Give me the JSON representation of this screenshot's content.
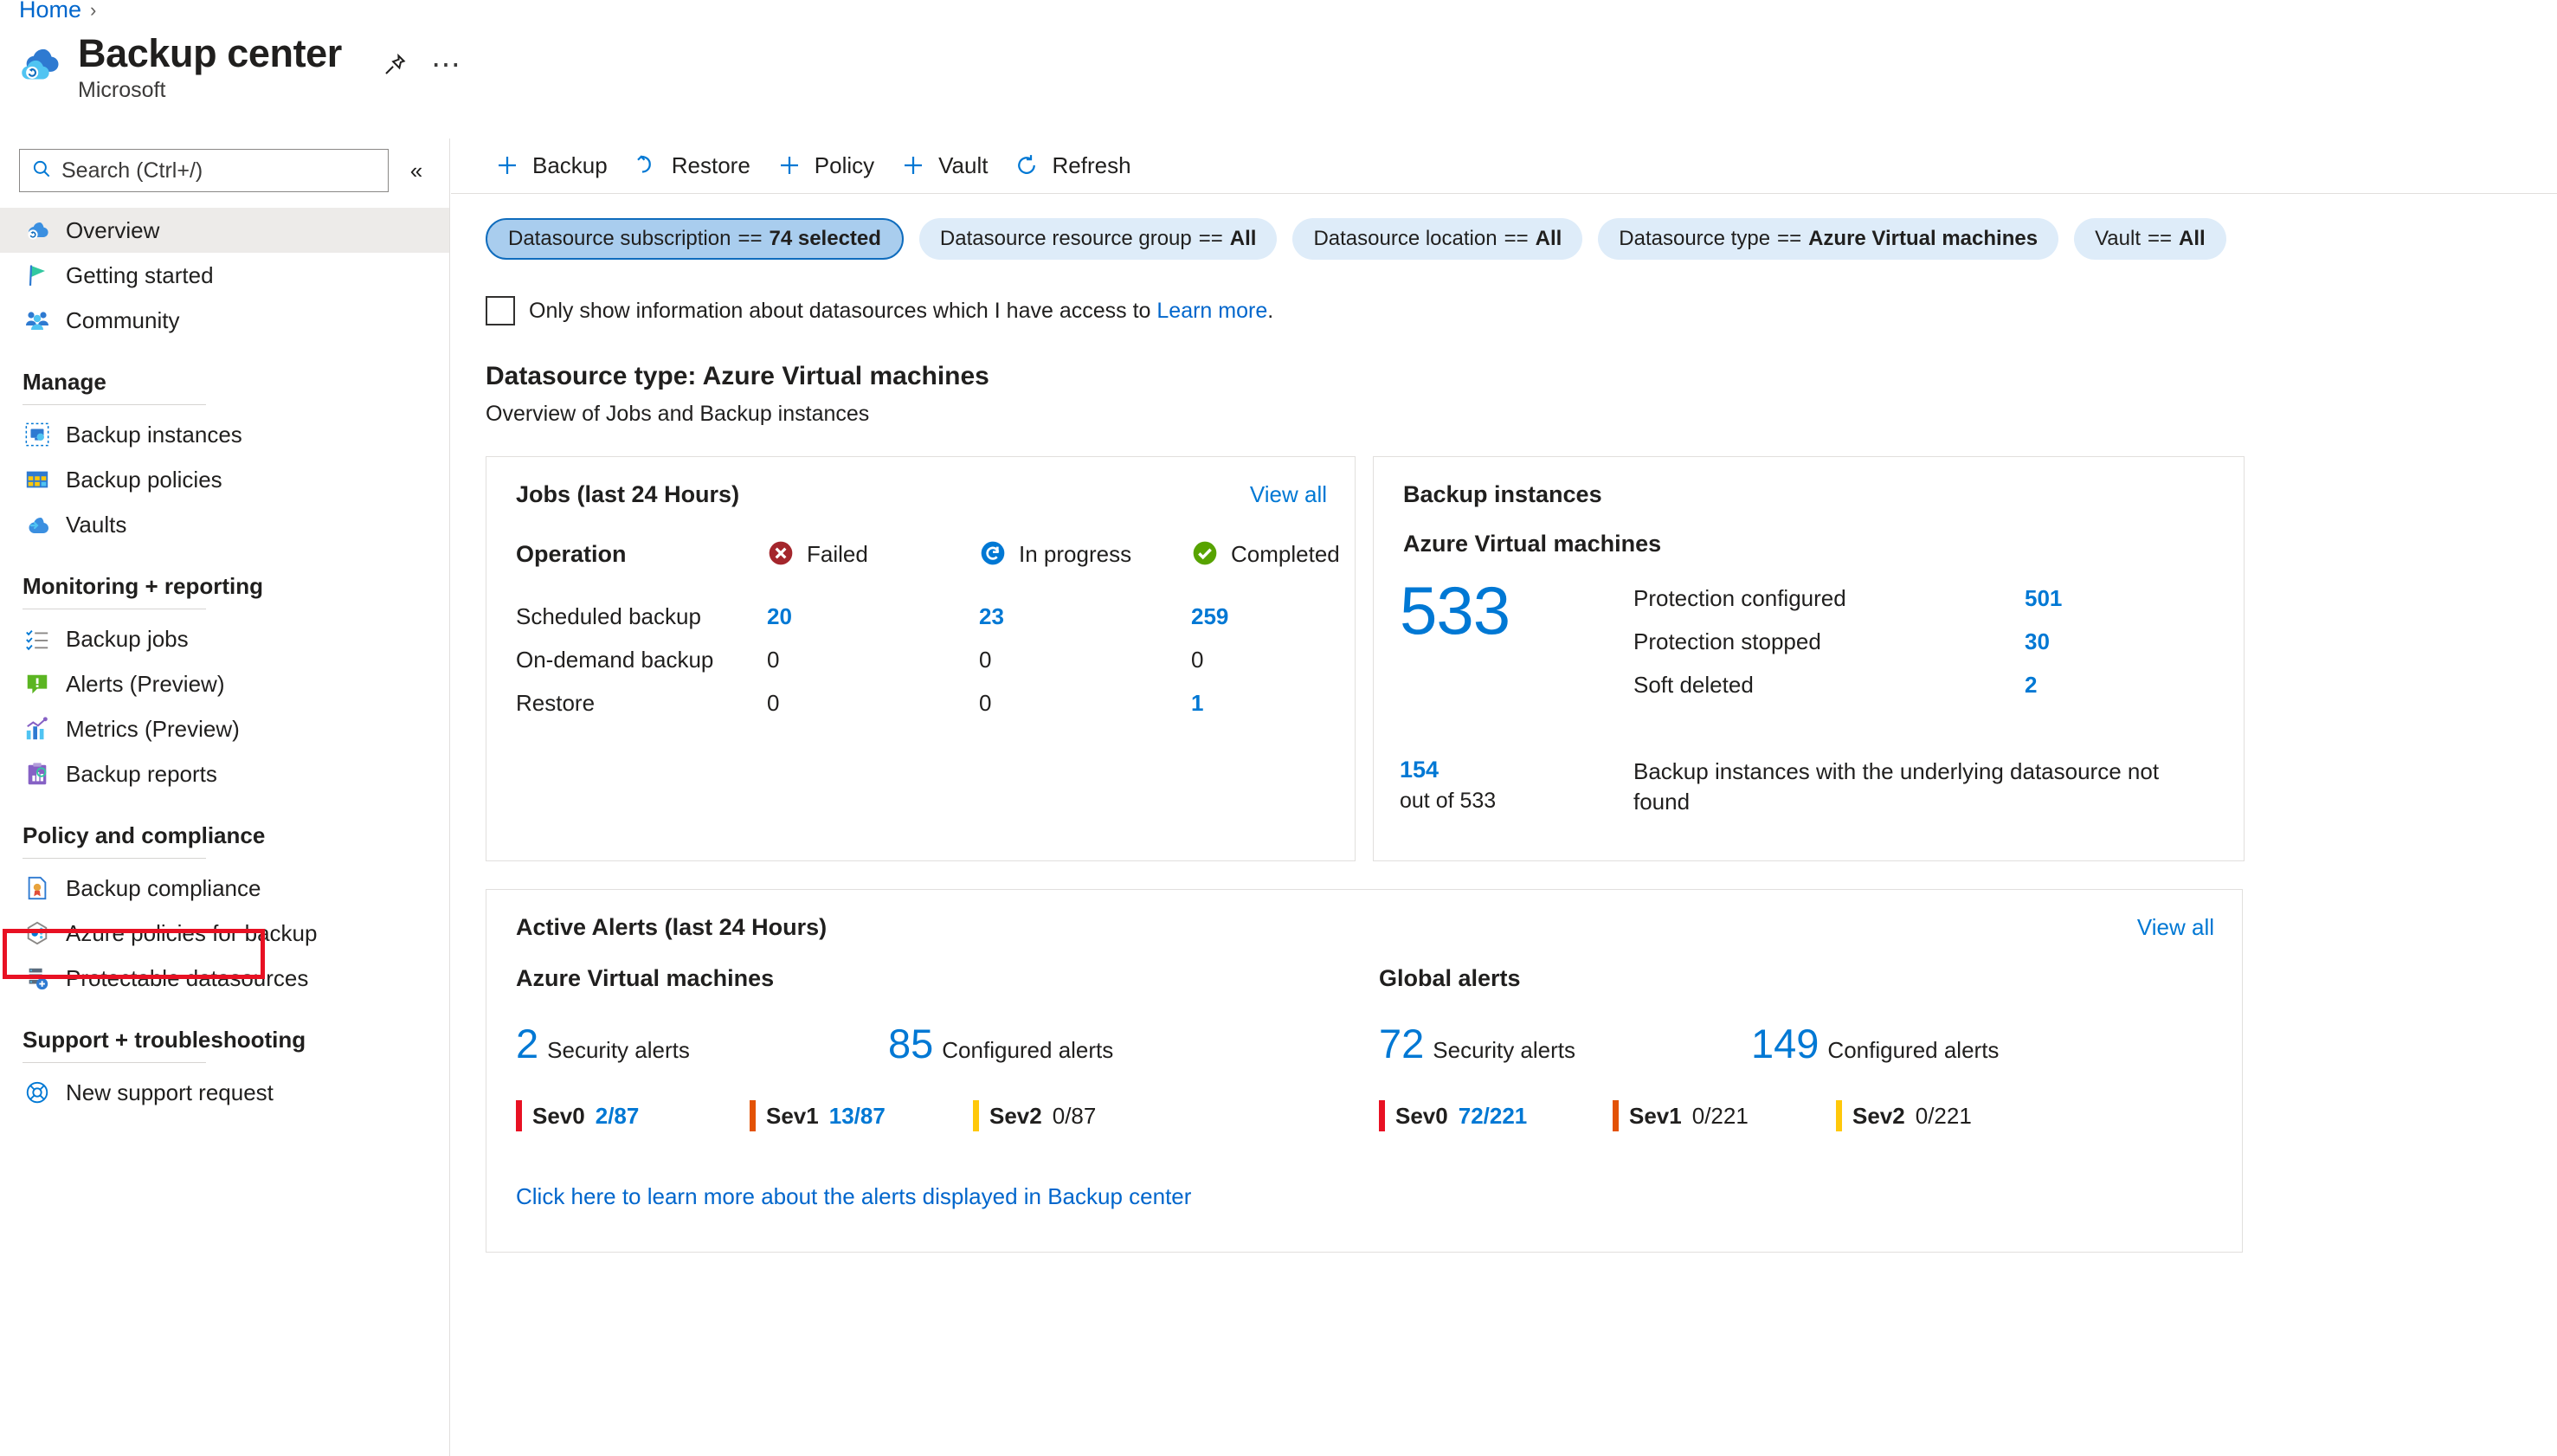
{
  "breadcrumb": {
    "home": "Home",
    "separator": "›"
  },
  "header": {
    "title": "Backup center",
    "subtitle": "Microsoft",
    "pin_label": "pin-icon",
    "more_label": "⋯"
  },
  "sidebar": {
    "search": {
      "placeholder": "Search (Ctrl+/)"
    },
    "collapse": "«",
    "top_items": [
      {
        "label": "Overview",
        "icon": "backup-center-icon",
        "active": true
      },
      {
        "label": "Getting started",
        "icon": "flag-icon",
        "active": false
      },
      {
        "label": "Community",
        "icon": "community-icon",
        "active": false
      }
    ],
    "groups": [
      {
        "title": "Manage",
        "items": [
          {
            "label": "Backup instances",
            "icon": "backup-instances-icon"
          },
          {
            "label": "Backup policies",
            "icon": "backup-policies-icon"
          },
          {
            "label": "Vaults",
            "icon": "vaults-icon"
          }
        ]
      },
      {
        "title": "Monitoring + reporting",
        "items": [
          {
            "label": "Backup jobs",
            "icon": "backup-jobs-icon"
          },
          {
            "label": "Alerts (Preview)",
            "icon": "alerts-icon"
          },
          {
            "label": "Metrics (Preview)",
            "icon": "metrics-icon",
            "highlighted": true
          },
          {
            "label": "Backup reports",
            "icon": "backup-reports-icon"
          }
        ]
      },
      {
        "title": "Policy and compliance",
        "items": [
          {
            "label": "Backup compliance",
            "icon": "compliance-icon"
          },
          {
            "label": "Azure policies for backup",
            "icon": "azure-policy-icon"
          },
          {
            "label": "Protectable datasources",
            "icon": "protectable-datasources-icon"
          }
        ]
      },
      {
        "title": "Support + troubleshooting",
        "items": [
          {
            "label": "New support request",
            "icon": "support-icon"
          }
        ]
      }
    ]
  },
  "toolbar": {
    "items": [
      {
        "label": "Backup",
        "icon": "plus-icon"
      },
      {
        "label": "Restore",
        "icon": "restore-icon"
      },
      {
        "label": "Policy",
        "icon": "plus-icon"
      },
      {
        "label": "Vault",
        "icon": "plus-icon"
      },
      {
        "label": "Refresh",
        "icon": "refresh-icon"
      }
    ]
  },
  "filters": [
    {
      "name": "Datasource subscription",
      "op": "==",
      "value": "74 selected",
      "selected": true
    },
    {
      "name": "Datasource resource group",
      "op": "==",
      "value": "All",
      "selected": false
    },
    {
      "name": "Datasource location",
      "op": "==",
      "value": "All",
      "selected": false
    },
    {
      "name": "Datasource type",
      "op": "==",
      "value": "Azure Virtual machines",
      "selected": false
    },
    {
      "name": "Vault",
      "op": "==",
      "value": "All",
      "selected": false
    }
  ],
  "access_row": {
    "checked": false,
    "text": "Only show information about datasources which I have access to ",
    "link": "Learn more",
    "period": "."
  },
  "page_section": {
    "title": "Datasource type: Azure Virtual machines",
    "subtitle": "Overview of Jobs and Backup instances"
  },
  "jobs_card": {
    "title": "Jobs (last 24 Hours)",
    "view_all": "View all",
    "columns": {
      "operation": "Operation",
      "failed": "Failed",
      "in_progress": "In progress",
      "completed": "Completed"
    },
    "rows": [
      {
        "operation": "Scheduled backup",
        "failed": "20",
        "failed_blue": true,
        "in_progress": "23",
        "in_progress_blue": true,
        "completed": "259",
        "completed_blue": true
      },
      {
        "operation": "On-demand backup",
        "failed": "0",
        "failed_blue": false,
        "in_progress": "0",
        "in_progress_blue": false,
        "completed": "0",
        "completed_blue": false
      },
      {
        "operation": "Restore",
        "failed": "0",
        "failed_blue": false,
        "in_progress": "0",
        "in_progress_blue": false,
        "completed": "1",
        "completed_blue": true
      }
    ]
  },
  "backup_instances_card": {
    "title": "Backup instances",
    "subtitle": "Azure Virtual machines",
    "total": "533",
    "lines": [
      {
        "label": "Protection configured",
        "value": "501"
      },
      {
        "label": "Protection stopped",
        "value": "30"
      },
      {
        "label": "Soft deleted",
        "value": "2"
      }
    ],
    "footer_number": "154",
    "footer_outof": "out of 533",
    "footer_text": "Backup instances with the underlying datasource not found"
  },
  "alerts_card": {
    "title": "Active Alerts (last 24 Hours)",
    "view_all": "View all",
    "columns": [
      {
        "title": "Azure Virtual machines",
        "counts": [
          {
            "num": "2",
            "label": "Security alerts"
          },
          {
            "num": "85",
            "label": "Configured alerts"
          }
        ],
        "severities": [
          {
            "name": "Sev0",
            "value": "2/87",
            "color": "#e81123",
            "blue": true
          },
          {
            "name": "Sev1",
            "value": "13/87",
            "color": "#e35205",
            "blue": true
          },
          {
            "name": "Sev2",
            "value": "0/87",
            "color": "#ffc80a",
            "blue": false
          }
        ]
      },
      {
        "title": "Global alerts",
        "counts": [
          {
            "num": "72",
            "label": "Security alerts"
          },
          {
            "num": "149",
            "label": "Configured alerts"
          }
        ],
        "severities": [
          {
            "name": "Sev0",
            "value": "72/221",
            "color": "#e81123",
            "blue": true
          },
          {
            "name": "Sev1",
            "value": "0/221",
            "color": "#e35205",
            "blue": false
          },
          {
            "name": "Sev2",
            "value": "0/221",
            "color": "#ffc80a",
            "blue": false
          }
        ]
      }
    ],
    "footer_link": "Click here to learn more about the alerts displayed in Backup center"
  },
  "colors": {
    "accent": "#0078d4",
    "link": "#0066cc",
    "failed": "#a4262c",
    "in_progress": "#0078d4",
    "completed": "#57a300",
    "highlight_box": "#e81123",
    "pill_bg": "#deecf9",
    "pill_selected_bg": "#a9cdee",
    "pill_selected_border": "#0f6cbd"
  }
}
